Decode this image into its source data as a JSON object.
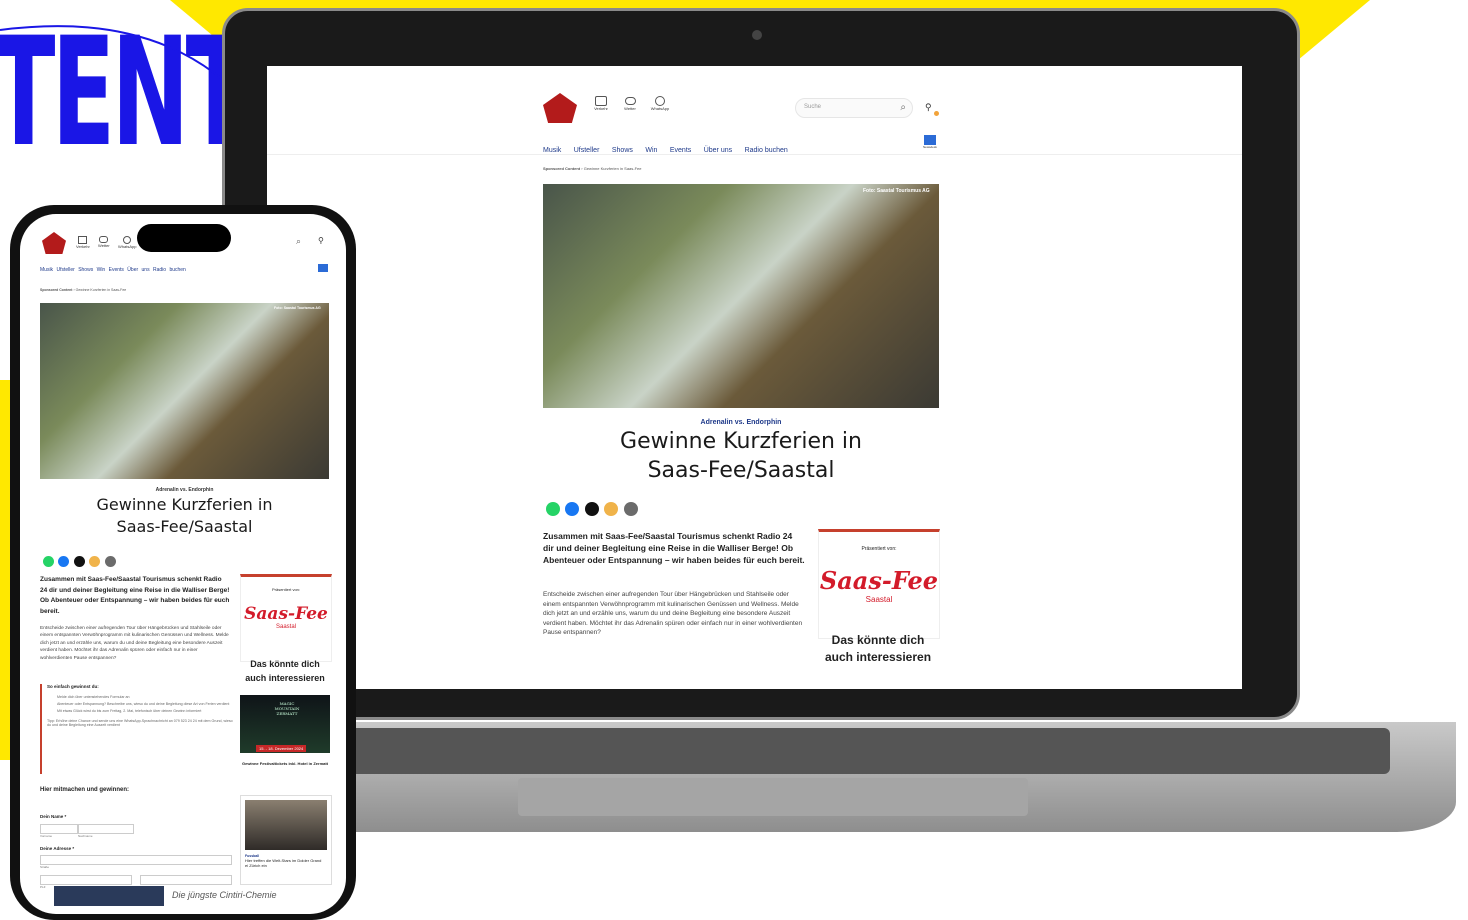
{
  "promo": {
    "headline_word": "TENT"
  },
  "site": {
    "header_icons": [
      {
        "label": "Verkehr",
        "icon": "car-icon"
      },
      {
        "label": "Wetter",
        "icon": "cloud-icon"
      },
      {
        "label": "WhatsApp",
        "icon": "whatsapp-icon"
      }
    ],
    "search_placeholder": "Suche",
    "nav": [
      "Musik",
      "Ufsteller",
      "Shows",
      "Win",
      "Events",
      "Über uns",
      "Radio buchen"
    ],
    "newsdesk_label": "Newsdesk",
    "breadcrumb": {
      "section": "Sponsored Content",
      "separator": "›",
      "current": "Gewinne Kurzferien in Saas-Fee"
    },
    "photo_credit": "Foto: Saastal Tourismus AG",
    "kicker": "Adrenalin vs. Endorphin",
    "title_line1": "Gewinne Kurzferien in",
    "title_line2": "Saas-Fee/Saastal",
    "lead": "Zusammen mit Saas-Fee/Saastal Tourismus schenkt Radio 24 dir und deiner Begleitung eine Reise in die Walliser Berge! Ob Abenteuer oder Entspannung – wir haben beides für euch bereit.",
    "body": "Entscheide zwischen einer aufregenden Tour über Hängebrücken und Stahlseile oder einem entspannten Verwöhnprogramm mit kulinarischen Genüssen und Wellness. Melde dich jetzt an und erzähle uns, warum du und deine Begleitung eine besondere Auszeit verdient haben. Möchtet ihr das Adrenalin spüren oder einfach nur in einer wohlverdienten Pause entspannen?",
    "sponsor_label": "Präsentiert von:",
    "sponsor_logo_text": "Saas-Fee",
    "sponsor_logo_sub": "Saastal",
    "related_heading_line1": "Das könnte dich",
    "related_heading_line2": "auch interessieren",
    "share_colors": [
      "#25d366",
      "#1877f2",
      "#111111",
      "#f0b34a",
      "#6b6b6b"
    ]
  },
  "mobile": {
    "how_to_heading": "So einfach gewinnst du:",
    "steps": [
      "Melde dich über untenstehendes Formular an",
      "Abenteuer oder Entspannung? Beschreibe uns, wieso du und deine Begleitung diese Art von Ferien verdient",
      "Mit etwas Glück wirst du bis zum Freitag, 2. Mai, telefonisch über deinen Gewinn informiert"
    ],
    "tip": "Tipp: Erhöhe deine Chance und sende uns eine WhatsApp-Sprachnachricht an 079 523 24 24 mit dem Grund, wieso du und deine Begleitung eine Auszeit verdient",
    "form_heading": "Hier mitmachen und gewinnen:",
    "name_label": "Dein Name *",
    "first_label": "Vorname",
    "last_label": "Nachname",
    "address_label": "Deine Adresse *",
    "street_label": "Straße",
    "plz_label": "PLZ",
    "ort_label": "Ort",
    "related1": {
      "banner": "15. - 18. Dezember 2024",
      "poster": "MAGIC MOUNTAIN ZERMATT",
      "caption": "Gewinne Festivaltickets inkl. Hotel in Zermatt"
    },
    "related2": {
      "tag": "Fussball",
      "caption": "Hier treffen die Welt-Stars im Dolder Grand ei Zürich ein"
    },
    "bottom_teaser": "Die jüngste Cintiri-Chemie"
  },
  "colors": {
    "accent_blue": "#1a16e6",
    "brand_yellow": "#ffe800",
    "brand_red": "#d31b2a",
    "nav_blue": "#1f3a8a"
  }
}
